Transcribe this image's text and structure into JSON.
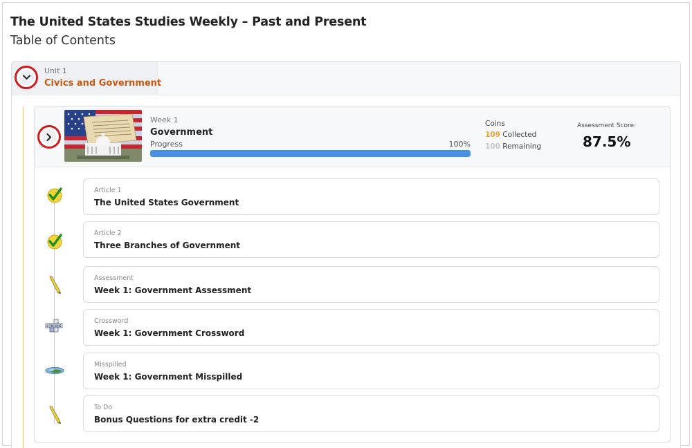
{
  "book": {
    "title": "The United States Studies Weekly – Past and Present",
    "subtitle": "Table of Contents"
  },
  "unit": {
    "label": "Unit 1",
    "name": "Civics and Government",
    "toggle_icon": "chevron-down-icon"
  },
  "week": {
    "label": "Week 1",
    "name": "Government",
    "progress_label": "Progress",
    "progress_percent": "100%",
    "progress_fraction": 1.0,
    "toggle_icon": "chevron-right-icon",
    "thumbnail": "capitol-flag-constitution-image",
    "coins": {
      "title": "Coins",
      "collected_value": "109",
      "collected_label": "Collected",
      "remaining_value": "100",
      "remaining_label": "Remaining"
    },
    "assessment": {
      "label": "Assessment Score:",
      "score": "87.5%"
    }
  },
  "items": [
    {
      "type": "Article 1",
      "title": "The United States Government",
      "icon": "checkmark-icon"
    },
    {
      "type": "Article 2",
      "title": "Three Branches of Government",
      "icon": "checkmark-icon"
    },
    {
      "type": "Assessment",
      "title": "Week 1: Government Assessment",
      "icon": "pencil-icon"
    },
    {
      "type": "Crossword",
      "title": "Week 1: Government Crossword",
      "icon": "crossword-icon"
    },
    {
      "type": "Misspilled",
      "title": "Week 1: Government Misspilled",
      "icon": "misspilled-icon"
    },
    {
      "type": "To Do",
      "title": "Bonus Questions for extra credit -2",
      "icon": "pencil-icon"
    }
  ],
  "colors": {
    "unit_name": "#c75b12",
    "progress_fill": "#4a90e2",
    "coins_collected": "#f0a132",
    "highlight_ring": "#d21a1a"
  }
}
